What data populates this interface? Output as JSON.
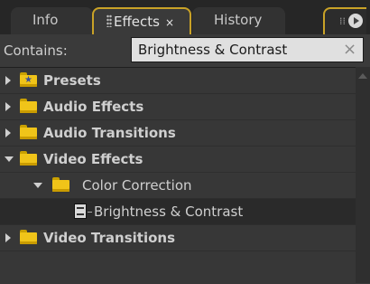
{
  "tabs": [
    {
      "label": "Info"
    },
    {
      "label": "Effects",
      "close": "×"
    },
    {
      "label": "History"
    }
  ],
  "search": {
    "label": "Contains:",
    "value": "Brightness & Contrast",
    "clear": "×"
  },
  "tree": [
    {
      "label": "Presets",
      "expanded": false,
      "icon": "preset-folder-icon"
    },
    {
      "label": "Audio Effects",
      "expanded": false,
      "icon": "folder-icon"
    },
    {
      "label": "Audio Transitions",
      "expanded": false,
      "icon": "folder-icon"
    },
    {
      "label": "Video Effects",
      "expanded": true,
      "icon": "folder-icon"
    },
    {
      "label": "Color Correction",
      "expanded": true,
      "icon": "folder-icon"
    },
    {
      "label": "Brightness & Contrast",
      "icon": "video-effect-icon",
      "selected": true
    },
    {
      "label": "Video Transitions",
      "expanded": false,
      "icon": "folder-icon"
    }
  ],
  "colors": {
    "accent": "#c9a227",
    "folder": "#f0c419",
    "panel": "#3a3a3a"
  }
}
